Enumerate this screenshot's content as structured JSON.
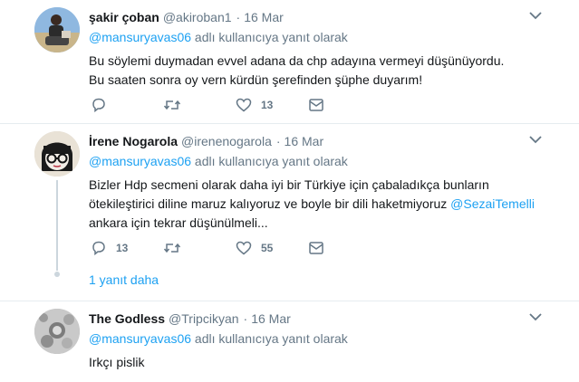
{
  "tweets": [
    {
      "name": "şakir çoban",
      "handle": "@akiroban1",
      "dot": "·",
      "time": "16 Mar",
      "reply_prefix": "@mansuryavas06",
      "reply_suffix": " adlı kullanıcıya yanıt olarak",
      "lines": [
        "Bu söylemi duymadan evvel adana da chp adayına vermeyi düşünüyordu.",
        "Bu saaten sonra oy vern kürdün şerefinden şüphe duyarım!"
      ],
      "reply_count": "",
      "retweet_count": "",
      "like_count": "13"
    },
    {
      "name": "İrene Nogarola",
      "handle": "@irenenogarola",
      "dot": "·",
      "time": "16 Mar",
      "reply_prefix": "@mansuryavas06",
      "reply_suffix": " adlı kullanıcıya yanıt olarak",
      "line1": "Bizler Hdp secmeni olarak daha iyi bir Türkiye için çabaladıkça bunların",
      "line2_text": "ötekileştirici diline maruz kalıyoruz ve boyle bir dili haketmiyoruz ",
      "line2_mention": "@SezaiTemelli",
      "line3": "ankara için tekrar düşünülmeli...",
      "reply_count": "13",
      "retweet_count": "",
      "like_count": "55",
      "more_replies": "1 yanıt daha"
    },
    {
      "name": "The Godless",
      "handle": "@Tripcikyan",
      "dot": "·",
      "time": "16 Mar",
      "reply_prefix": "@mansuryavas06",
      "reply_suffix": " adlı kullanıcıya yanıt olarak",
      "lines": [
        "Irkçı pislik"
      ]
    }
  ],
  "colors": {
    "link": "#1da1f2",
    "muted": "#657786",
    "text": "#14171a",
    "separator": "#e6ecf0"
  },
  "icons": [
    "reply-icon",
    "retweet-icon",
    "like-icon",
    "dm-icon",
    "chevron-down-icon"
  ]
}
